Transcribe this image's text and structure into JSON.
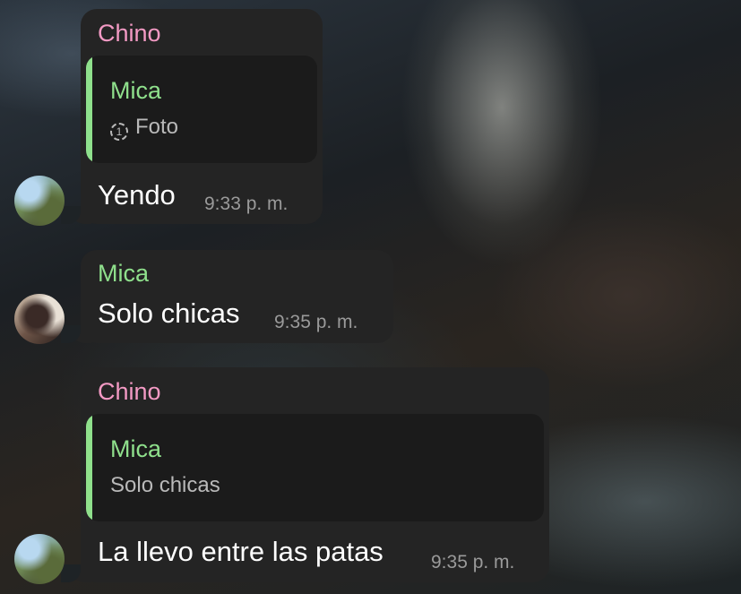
{
  "messages": [
    {
      "sender": "Chino",
      "reply_to": {
        "name": "Mica",
        "text": "Foto",
        "icon": "view-once-icon",
        "icon_glyph": "1"
      },
      "text": "Yendo",
      "time": "9:33 p. m."
    },
    {
      "sender": "Mica",
      "text": "Solo chicas",
      "time": "9:35 p. m."
    },
    {
      "sender": "Chino",
      "reply_to": {
        "name": "Mica",
        "text": "Solo chicas"
      },
      "text": "La llevo entre las patas",
      "time": "9:35 p. m."
    }
  ],
  "colors": {
    "chino_name": "#f39ac4",
    "mica_name": "#8fe08c",
    "bubble": "#242424",
    "quote_bg": "#1b1b1b"
  }
}
